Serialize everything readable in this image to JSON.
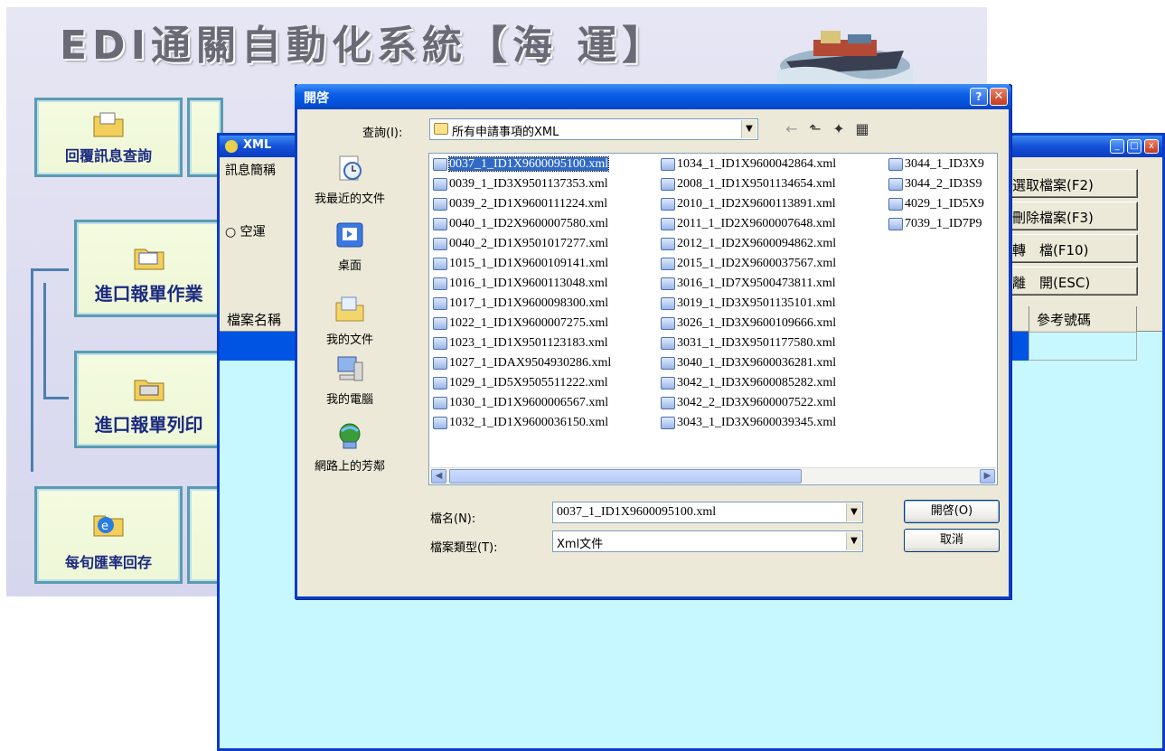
{
  "app": {
    "title": "EDI通關自動化系統【海 運】",
    "menu": {
      "reply_query": "回覆訊息查詢",
      "import_declaration": "進口報單作業",
      "import_print": "進口報單列印",
      "exchange_rate": "每旬匯率回存"
    }
  },
  "xml_window": {
    "title": "XML",
    "group_label": "訊息簡稱",
    "radio_air": "空運",
    "buttons": {
      "select_file": "選取檔案(F2)",
      "delete_file": "刪除檔案(F3)",
      "convert": "轉　檔(F10)",
      "exit": "離　開(ESC)"
    },
    "columns": {
      "filename": "檔案名稱",
      "reference": "參考號碼"
    }
  },
  "dialog": {
    "title": "開啓",
    "help_glyph": "?",
    "close_glyph": "✕",
    "look_in_label": "查詢(I):",
    "look_in_value": "所有申請事項的XML",
    "places": {
      "recent": "我最近的文件",
      "desktop": "桌面",
      "my_documents": "我的文件",
      "my_computer": "我的電腦",
      "network": "網路上的芳鄰"
    },
    "files": {
      "col1": [
        "0037_1_ID1X9600095100.xml",
        "0039_1_ID3X9501137353.xml",
        "0039_2_ID1X9600111224.xml",
        "0040_1_ID2X9600007580.xml",
        "0040_2_ID1X9501017277.xml",
        "1015_1_ID1X9600109141.xml",
        "1016_1_ID1X9600113048.xml",
        "1017_1_ID1X9600098300.xml",
        "1022_1_ID1X9600007275.xml",
        "1023_1_ID1X9501123183.xml",
        "1027_1_IDAX9504930286.xml",
        "1029_1_ID5X9505511222.xml",
        "1030_1_ID1X9600006567.xml",
        "1032_1_ID1X9600036150.xml"
      ],
      "col2": [
        "1034_1_ID1X9600042864.xml",
        "2008_1_ID1X9501134654.xml",
        "2010_1_ID2X9600113891.xml",
        "2011_1_ID2X9600007648.xml",
        "2012_1_ID2X9600094862.xml",
        "2015_1_ID2X9600037567.xml",
        "3016_1_ID7X9500473811.xml",
        "3019_1_ID3X9501135101.xml",
        "3026_1_ID3X9600109666.xml",
        "3031_1_ID3X9501177580.xml",
        "3040_1_ID3X9600036281.xml",
        "3042_1_ID3X9600085282.xml",
        "3042_2_ID3X9600007522.xml",
        "3043_1_ID3X9600039345.xml"
      ],
      "col3": [
        "3044_1_ID3X9",
        "3044_2_ID3S9",
        "4029_1_ID5X9",
        "7039_1_ID7P9"
      ]
    },
    "file_name_label": "檔名(N):",
    "file_name_value": "0037_1_ID1X9600095100.xml",
    "file_type_label": "檔案類型(T):",
    "file_type_value": "Xml文件",
    "open_button": "開啓(O)",
    "cancel_button": "取消"
  },
  "colors": {
    "title_blue": "#0a44c0",
    "selection": "#316ac5",
    "xml_bg": "#c8f8ff"
  }
}
